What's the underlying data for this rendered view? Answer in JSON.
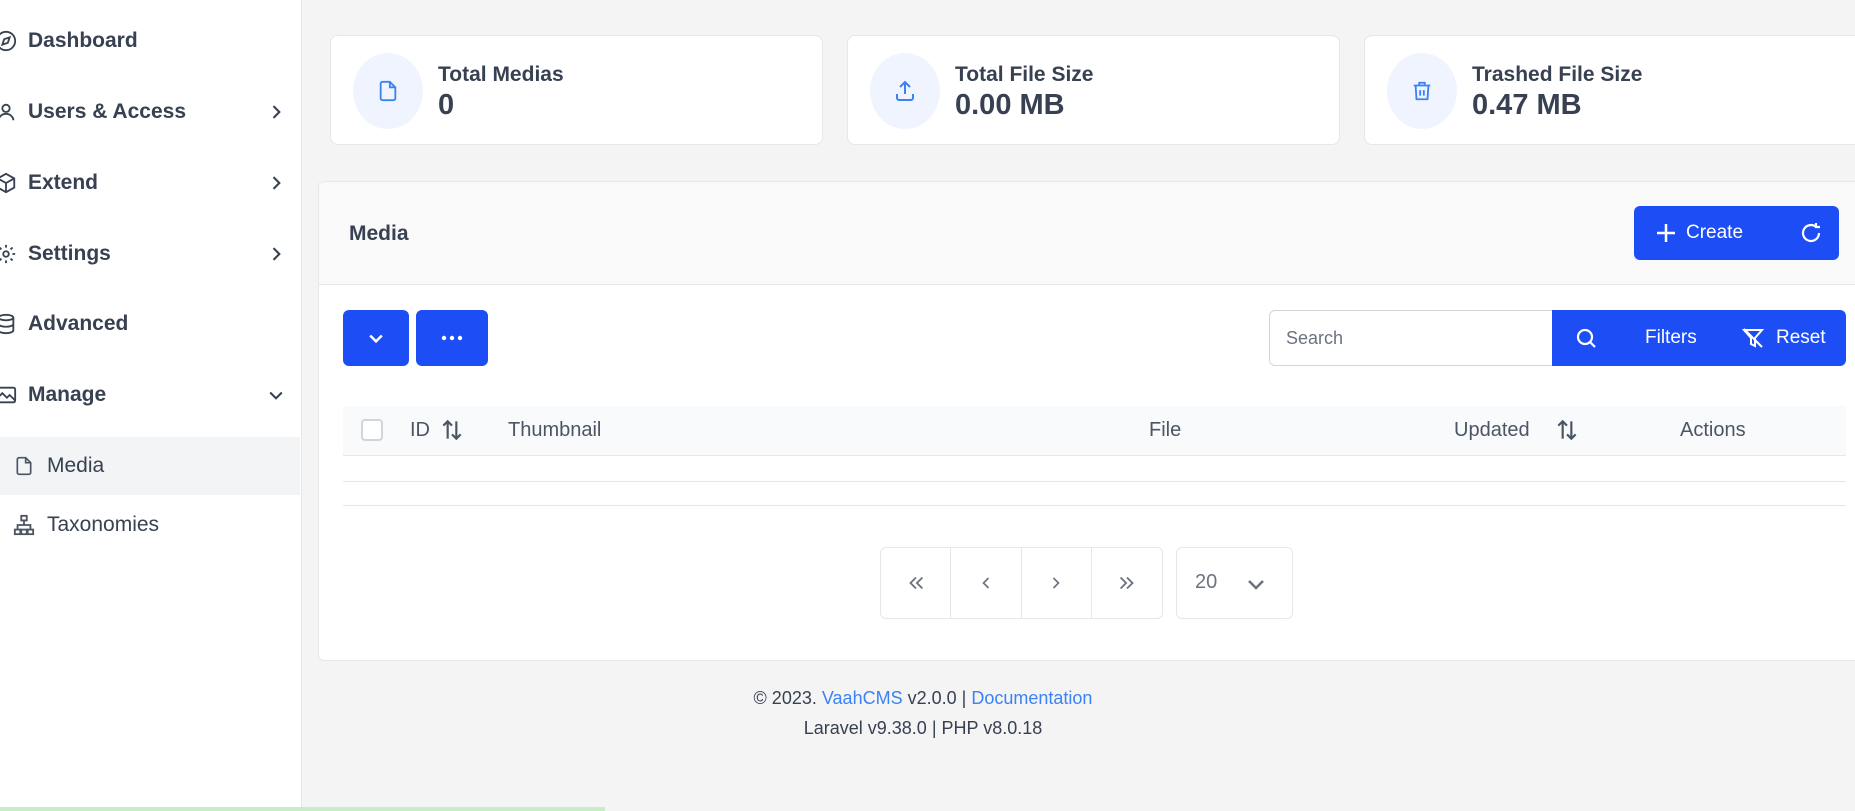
{
  "sidebar": {
    "items": [
      {
        "label": "Dashboard",
        "icon": "compass-icon"
      },
      {
        "label": "Users & Access",
        "icon": "user-icon"
      },
      {
        "label": "Extend",
        "icon": "box-icon"
      },
      {
        "label": "Settings",
        "icon": "gear-icon"
      },
      {
        "label": "Advanced",
        "icon": "database-icon"
      },
      {
        "label": "Manage",
        "icon": "images-icon"
      }
    ],
    "subitems": [
      {
        "label": "Media",
        "icon": "file-icon",
        "active": true
      },
      {
        "label": "Taxonomies",
        "icon": "sitemap-icon"
      }
    ]
  },
  "stats": [
    {
      "title": "Total Medias",
      "value": "0",
      "icon": "file-icon"
    },
    {
      "title": "Total File Size",
      "value": "0.00 MB",
      "icon": "upload-icon"
    },
    {
      "title": "Trashed File Size",
      "value": "0.47 MB",
      "icon": "trash-icon"
    }
  ],
  "panel": {
    "title": "Media",
    "create_label": "Create"
  },
  "search": {
    "placeholder": "Search",
    "filters_label": "Filters",
    "reset_label": "Reset"
  },
  "table": {
    "columns": [
      "ID",
      "Thumbnail",
      "File",
      "Updated",
      "Actions"
    ]
  },
  "pagination": {
    "per_page": "20"
  },
  "footer": {
    "copyright": "© 2023.",
    "brand": "VaahCMS",
    "version": "v2.0.0",
    "sep": "|",
    "docs": "Documentation",
    "laravel": "Laravel v9.38.0",
    "php": "PHP v8.0.18"
  },
  "colors": {
    "primary": "#1d4ef5",
    "link": "#3b82f6"
  }
}
